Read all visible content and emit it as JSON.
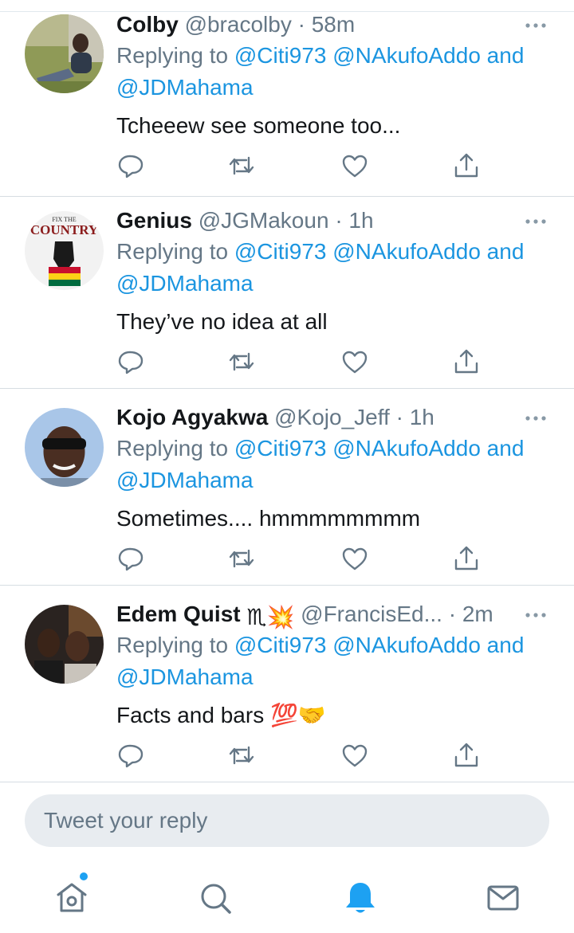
{
  "tweets": [
    {
      "name": "Colby",
      "handle": "@bracolby",
      "separator": "·",
      "time": "58m",
      "replying_prefix": "Replying to",
      "mention_1": "@Citi973",
      "mention_2": "@NAkufoAddo",
      "conjunction": "and",
      "mention_3": "@JDMahama",
      "text": "Tcheeew see someone too..."
    },
    {
      "name": "Genius",
      "handle": "@JGMakoun",
      "separator": "·",
      "time": "1h",
      "replying_prefix": "Replying to",
      "mention_1": "@Citi973",
      "mention_2": "@NAkufoAddo",
      "conjunction": "and",
      "mention_3": "@JDMahama",
      "text": "They’ve no idea at all",
      "avatar_text_top": "FIX THE",
      "avatar_text_main": "COUNTRY"
    },
    {
      "name": "Kojo Agyakwa",
      "handle": "@Kojo_Jeff",
      "separator": "·",
      "time": "1h",
      "replying_prefix": "Replying to",
      "mention_1": "@Citi973",
      "mention_2": "@NAkufoAddo",
      "conjunction": "and",
      "mention_3": "@JDMahama",
      "text": "Sometimes.... hmmmmmmmm"
    },
    {
      "name": "Edem Quist",
      "name_emoji_1": "♏",
      "name_emoji_2": "💥",
      "handle": "@FrancisEd...",
      "separator": "·",
      "time": "2m",
      "replying_prefix": "Replying to",
      "mention_1": "@Citi973",
      "mention_2": "@NAkufoAddo",
      "conjunction": "and",
      "mention_3": "@JDMahama",
      "text": "Facts and bars",
      "text_emoji_1": "💯",
      "text_emoji_2": "🤝"
    }
  ],
  "reply_box": {
    "placeholder": "Tweet your reply"
  },
  "tabbar": {
    "items": [
      "home",
      "search",
      "notifications",
      "messages"
    ],
    "active": "notifications",
    "home_has_badge": true
  },
  "colors": {
    "accent": "#1da1f2",
    "mention": "#1b95e0",
    "secondary_text": "#657786",
    "divider": "#e1e8ed"
  }
}
